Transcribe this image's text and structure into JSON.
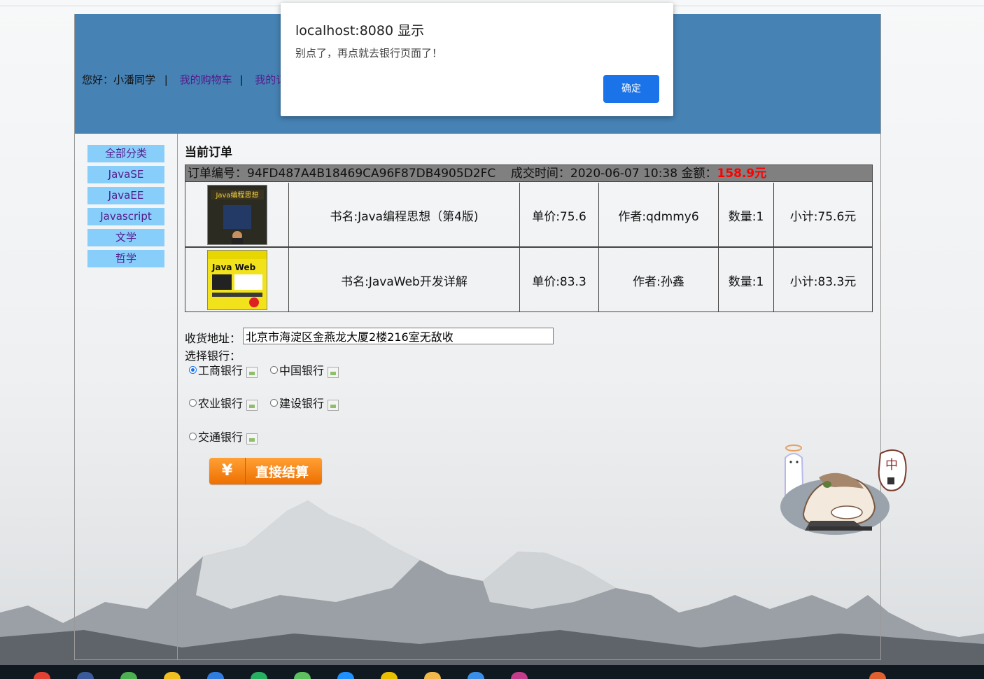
{
  "header": {
    "greeting": "您好：小潘同学",
    "sep1": "|",
    "cart_link": "我的购物车",
    "sep2": "|",
    "orders_link": "我的订单"
  },
  "sidebar": {
    "items": [
      {
        "label": "全部分类"
      },
      {
        "label": "JavaSE"
      },
      {
        "label": "JavaEE"
      },
      {
        "label": "Javascript"
      },
      {
        "label": "文学"
      },
      {
        "label": "哲学"
      }
    ]
  },
  "order": {
    "title": "当前订单",
    "number_label": "订单编号：94FD487A4B18469CA96F87DB4905D2FC",
    "time_label": "成交时间：2020-06-07 10:38",
    "amount_label": "金额：",
    "amount_value": "158.9元",
    "items": [
      {
        "book": "书名:Java编程思想（第4版)",
        "price": "单价:75.6",
        "author": "作者:qdmmy6",
        "qty": "数量:1",
        "subtotal": "小计:75.6元",
        "cover_text": "Java编程思想"
      },
      {
        "book": "书名:JavaWeb开发详解",
        "price": "单价:83.3",
        "author": "作者:孙鑫",
        "qty": "数量:1",
        "subtotal": "小计:83.3元",
        "cover_text": "Java Web"
      }
    ]
  },
  "form": {
    "address_label": "收货地址：",
    "address_value": "北京市海淀区金燕龙大厦2楼216室无敌收",
    "bank_label": "选择银行：",
    "banks": [
      {
        "label": "工商银行",
        "checked": true
      },
      {
        "label": "中国银行",
        "checked": false
      },
      {
        "label": "农业银行",
        "checked": false
      },
      {
        "label": "建设银行",
        "checked": false
      },
      {
        "label": "交通银行",
        "checked": false
      }
    ],
    "pay_yen": "¥",
    "pay_label": "直接结算"
  },
  "mascot": {
    "speech": "中"
  },
  "dialog": {
    "title": "localhost:8080 显示",
    "message": "别点了，再点就去银行页面了！",
    "ok_label": "确定"
  },
  "colors": {
    "header_bg": "#4682b4",
    "sidebar_item_bg": "#87cefa",
    "order_head_bg": "#808080",
    "amount": "#ff0000",
    "dialog_button": "#1a73e8",
    "pay_button": "#f47f12"
  }
}
